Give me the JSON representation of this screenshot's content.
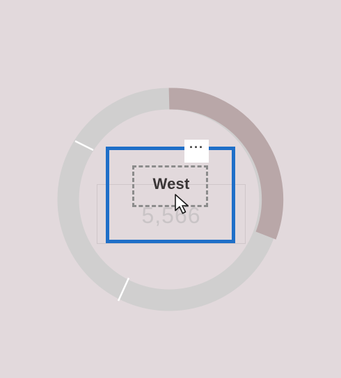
{
  "visual": {
    "region_label": "West",
    "value": "5,566",
    "more_options_glyph": "···"
  },
  "colors": {
    "background": "#e2d9dc",
    "ring_light": "#d0cfcf",
    "ring_highlight": "#b9a7a8",
    "selection_border": "#1f6fc8",
    "dashed_border": "#8c8c8c"
  },
  "icons": {
    "cursor": "mouse-pointer-icon",
    "more_options": "ellipsis-icon"
  }
}
